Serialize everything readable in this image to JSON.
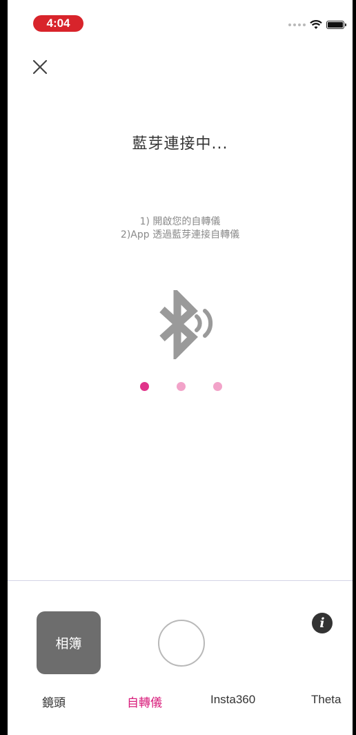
{
  "status_bar": {
    "time": "4:04"
  },
  "connect": {
    "title": "藍芽連接中...",
    "steps": [
      "1) 開啟您的自轉儀",
      "2)App 透過藍芽連接自轉儀"
    ]
  },
  "loading_dots": [
    {
      "color": "#e0338a"
    },
    {
      "color": "#f2a3c9"
    },
    {
      "color": "#f2a3c9"
    }
  ],
  "bottom_bar": {
    "album_label": "相簿",
    "info_glyph": "i",
    "tabs": [
      {
        "label": "鏡頭",
        "selected": false
      },
      {
        "label": "自轉儀",
        "selected": true
      },
      {
        "label": "Insta360",
        "selected": false
      },
      {
        "label": "Theta",
        "selected": false
      }
    ]
  },
  "colors": {
    "accent": "#d81b7a",
    "status_pill": "#d8242b",
    "album_bg": "#6d6d6d",
    "bluetooth_icon": "#9a9a9a"
  }
}
